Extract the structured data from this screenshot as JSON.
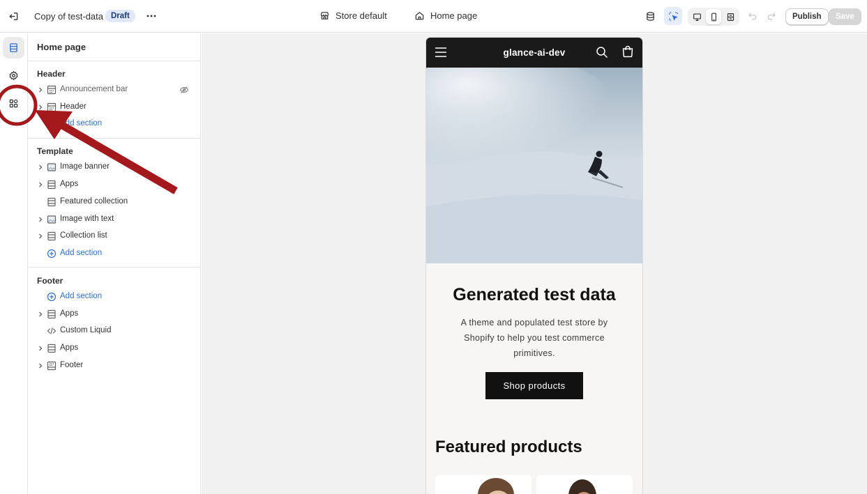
{
  "topbar": {
    "doc_title": "Copy of test-data",
    "status_badge": "Draft",
    "store_selector": "Store default",
    "page_selector": "Home page",
    "publish_label": "Publish",
    "save_label": "Save"
  },
  "rail": {
    "items": [
      "sections",
      "theme-settings",
      "app-embeds"
    ],
    "active": "sections"
  },
  "sidebar": {
    "title": "Home page",
    "groups": [
      {
        "title": "Header",
        "items": [
          {
            "label": "Announcement bar",
            "hidden": true
          },
          {
            "label": "Header"
          },
          {
            "label": "Add section",
            "type": "add"
          }
        ]
      },
      {
        "title": "Template",
        "items": [
          {
            "label": "Image banner"
          },
          {
            "label": "Apps"
          },
          {
            "label": "Featured collection"
          },
          {
            "label": "Image with text"
          },
          {
            "label": "Collection list"
          },
          {
            "label": "Add section",
            "type": "add"
          }
        ]
      },
      {
        "title": "Footer",
        "items": [
          {
            "label": "Add section",
            "type": "add"
          },
          {
            "label": "Apps"
          },
          {
            "label": "Custom Liquid"
          },
          {
            "label": "Apps"
          },
          {
            "label": "Footer"
          }
        ]
      }
    ]
  },
  "preview": {
    "store_name": "glance-ai-dev",
    "hero_title": "Generated test data",
    "hero_subtitle": "A theme and populated test store by Shopify to help you test commerce primitives.",
    "hero_button": "Shop products",
    "featured_title": "Featured products"
  },
  "annotation": {
    "color": "#a3191c"
  },
  "colors": {
    "link": "#2c6ecb",
    "badge_bg": "#e0e8f9",
    "store_header_bg": "#1a1a1a"
  }
}
